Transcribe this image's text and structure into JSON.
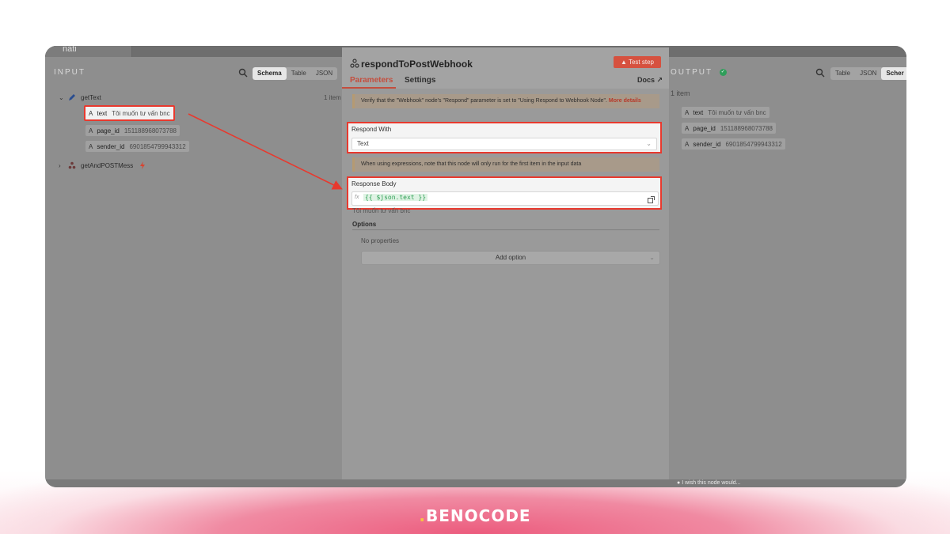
{
  "brand": {
    "prefix": ".",
    "name": "BENOCODE"
  },
  "window": {
    "top_tab": "nati"
  },
  "input": {
    "heading": "INPUT",
    "view_tabs": [
      "Schema",
      "Table",
      "JSON"
    ],
    "items_count": "1 item",
    "nodes": [
      {
        "name": "getText",
        "expanded": true
      },
      {
        "name": "getAndPOSTMess",
        "expanded": false
      }
    ],
    "fields": [
      {
        "type": "A",
        "key": "text",
        "value": "Tôi muốn tư vấn bnc"
      },
      {
        "type": "A",
        "key": "page_id",
        "value": "151188968073788"
      },
      {
        "type": "A",
        "key": "sender_id",
        "value": "6901854799943312"
      }
    ]
  },
  "modal": {
    "title": "respondToPostWebhook",
    "test_button": "Test step",
    "tabs": [
      "Parameters",
      "Settings"
    ],
    "docs": "Docs",
    "notice_respond": "Verify that the \"Webhook\" node's \"Respond\" parameter is set to \"Using Respond to Webhook Node\".",
    "notice_more": "More details",
    "respond_with_label": "Respond With",
    "respond_with_value": "Text",
    "notice_expr": "When using expressions, note that this node will only run for the first item in the input data",
    "response_body_label": "Response Body",
    "fx": "fx",
    "response_body_expr": "{{ $json.text }}",
    "response_body_preview": "Tôi muốn tư vấn bnc",
    "options_label": "Options",
    "no_properties": "No properties",
    "add_option": "Add option"
  },
  "output": {
    "heading": "OUTPUT",
    "view_tabs": [
      "Table",
      "JSON",
      "Scher"
    ],
    "items_count": "1 item",
    "fields": [
      {
        "type": "A",
        "key": "text",
        "value": "Tôi muốn tư vấn bnc"
      },
      {
        "type": "A",
        "key": "page_id",
        "value": "151188968073788"
      },
      {
        "type": "A",
        "key": "sender_id",
        "value": "6901854799943312"
      }
    ],
    "wish": "I wish this node would..."
  },
  "colors": {
    "highlight": "#e8392e",
    "accent": "#c44e3e",
    "success": "#2f9e5a",
    "brand_gradient": "#ec5b7d"
  }
}
